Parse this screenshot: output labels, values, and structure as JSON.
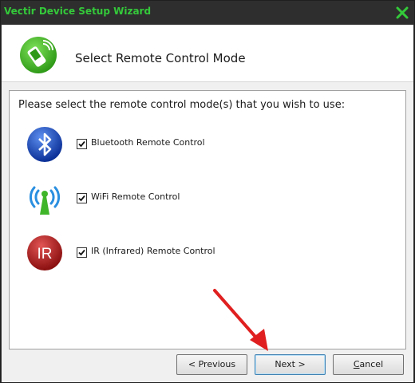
{
  "window": {
    "title": "Vectir Device Setup Wizard",
    "title_color": "#34c93a",
    "close_icon": "close-x-icon"
  },
  "header": {
    "title": "Select Remote Control Mode",
    "icon": "remote-phone-icon"
  },
  "panel": {
    "prompt": "Please select the remote control mode(s) that you wish to use:",
    "modes": [
      {
        "icon": "bluetooth-icon",
        "label": "Bluetooth Remote Control",
        "checked": true
      },
      {
        "icon": "wifi-antenna-icon",
        "label": "WiFi Remote Control",
        "checked": true
      },
      {
        "icon": "ir-icon",
        "icon_text": "IR",
        "label": "IR (Infrared) Remote Control",
        "checked": true
      }
    ]
  },
  "buttons": {
    "previous": "< Previous",
    "next": "Next >",
    "cancel_underlined_letter": "C",
    "cancel_rest": "ancel"
  },
  "annotation": {
    "arrow_color": "#e02020",
    "points_to": "Next >"
  }
}
